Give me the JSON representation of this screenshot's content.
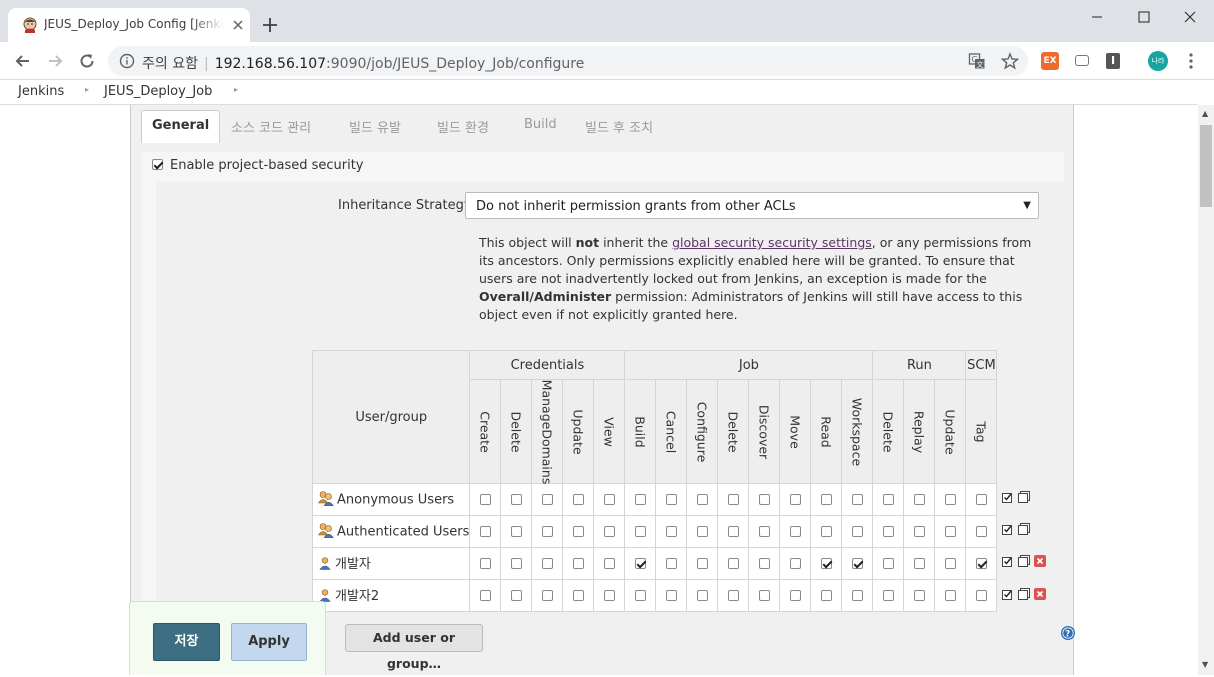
{
  "browser": {
    "tab_title": "JEUS_Deploy_Job Config [Jenkins]",
    "security_label": "주의 요함",
    "url_host": "192.168.56.107",
    "url_rest": ":9090/job/JEUS_Deploy_Job/configure",
    "profile_label": "나라"
  },
  "breadcrumb": [
    "Jenkins",
    "JEUS_Deploy_Job"
  ],
  "config_tabs": [
    {
      "label": "General",
      "active": true
    },
    {
      "label": "소스 코드 관리",
      "active": false
    },
    {
      "label": "빌드 유발",
      "active": false
    },
    {
      "label": "빌드 환경",
      "active": false
    },
    {
      "label": "Build",
      "active": false
    },
    {
      "label": "빌드 후 조치",
      "active": false
    }
  ],
  "security": {
    "enable_label": "Enable project-based security",
    "enabled": true,
    "inheritance_label": "Inheritance Strategy",
    "inheritance_value": "Do not inherit permission grants from other ACLs",
    "desc": {
      "p1": "This object will ",
      "not": "not",
      "p2": " inherit the ",
      "link": "global security security settings",
      "p3": ", or any permissions from its ancestors. Only permissions explicitly enabled here will be granted. To ensure that users are not inadvertently locked out from Jenkins, an exception is made for the ",
      "bold": "Overall/Administer",
      "p4": " permission: Administrators of Jenkins will still have access to this object even if not explicitly granted here."
    }
  },
  "matrix": {
    "user_header": "User/group",
    "groups": [
      {
        "name": "Credentials",
        "perms": [
          "Create",
          "Delete",
          "ManageDomains",
          "Update",
          "View"
        ]
      },
      {
        "name": "Job",
        "perms": [
          "Build",
          "Cancel",
          "Configure",
          "Delete",
          "Discover",
          "Move",
          "Read",
          "Workspace"
        ]
      },
      {
        "name": "Run",
        "perms": [
          "Delete",
          "Replay",
          "Update"
        ]
      },
      {
        "name": "SCM",
        "perms": [
          "Tag"
        ]
      }
    ],
    "rows": [
      {
        "name": "Anonymous Users",
        "icon": "group-icon",
        "checked": [
          0,
          0,
          0,
          0,
          0,
          0,
          0,
          0,
          0,
          0,
          0,
          0,
          0,
          0,
          0,
          0,
          0
        ],
        "removable": false
      },
      {
        "name": "Authenticated Users",
        "icon": "group-icon",
        "checked": [
          0,
          0,
          0,
          0,
          0,
          0,
          0,
          0,
          0,
          0,
          0,
          0,
          0,
          0,
          0,
          0,
          0
        ],
        "removable": false
      },
      {
        "name": "개발자",
        "icon": "user-icon",
        "checked": [
          0,
          0,
          0,
          0,
          0,
          1,
          0,
          0,
          0,
          0,
          0,
          1,
          1,
          0,
          0,
          0,
          1
        ],
        "removable": true
      },
      {
        "name": "개발자2",
        "icon": "user-icon",
        "checked": [
          0,
          0,
          0,
          0,
          0,
          0,
          0,
          0,
          0,
          0,
          0,
          0,
          0,
          0,
          0,
          0,
          0
        ],
        "removable": true
      }
    ]
  },
  "buttons": {
    "add_user": "Add user or group…",
    "save": "저장",
    "apply": "Apply"
  },
  "colors": {
    "save_bg": "#3d6e82",
    "apply_bg": "#c3d8ee",
    "link": "#5c3566"
  }
}
